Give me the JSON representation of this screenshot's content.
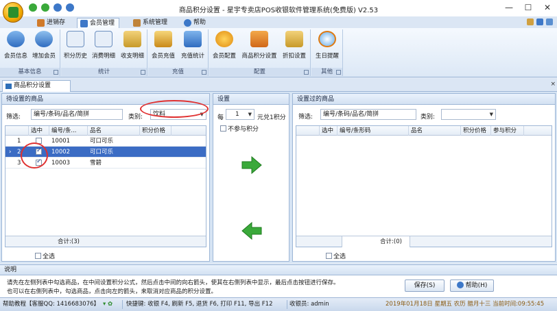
{
  "window": {
    "title": "商品积分设置 - 星宇专卖店POS收银软件管理系统(免费版) V2.53",
    "minimize": "—",
    "maximize": "☐",
    "close": "✕"
  },
  "ribbon_tabs": [
    {
      "label": "进销存",
      "icon": "cart-icon"
    },
    {
      "label": "会员管理",
      "icon": "members-icon",
      "active": true
    },
    {
      "label": "系统管理",
      "icon": "tools-icon"
    },
    {
      "label": "帮助",
      "icon": "help-icon"
    }
  ],
  "ribbon_groups": {
    "basic": {
      "label": "基本信息",
      "buttons": [
        "会员信息",
        "增加会员"
      ]
    },
    "stats": {
      "label": "统计",
      "buttons": [
        "积分历史",
        "消费明细",
        "收支明细"
      ]
    },
    "recharge": {
      "label": "充值",
      "buttons": [
        "会员充值",
        "充值统计"
      ]
    },
    "config": {
      "label": "配置",
      "buttons": [
        "会员配置",
        "商品积分设置",
        "折扣设置"
      ]
    },
    "other": {
      "label": "其他",
      "buttons": [
        "生日提醒"
      ]
    }
  },
  "panel_tab": "商品积分设置",
  "panel_more": "×",
  "left_pane": {
    "title": "待设置的商品",
    "filter_label": "筛选:",
    "filter_value": "编号/条码/品名/简拼",
    "category_label": "类别:",
    "category_value": "饮料",
    "columns": [
      "选中",
      "编号/条...",
      "品名",
      "积分价格"
    ],
    "rows": [
      {
        "idx": "1",
        "checked": false,
        "code": "10001",
        "name": "可口可乐",
        "points": ""
      },
      {
        "idx": "2",
        "checked": true,
        "code": "10002",
        "name": "可口可乐",
        "points": "",
        "selected": true,
        "marker": "›"
      },
      {
        "idx": "3",
        "checked": true,
        "code": "10003",
        "name": "雪碧",
        "points": ""
      }
    ],
    "total": "合计:(3)",
    "select_all": "全选"
  },
  "mid_pane": {
    "title": "设置",
    "per_label": "每",
    "per_value": "1",
    "rule_text": "元兑1积分",
    "no_points_label": "不参与积分"
  },
  "right_pane": {
    "title": "设置过的商品",
    "filter_label": "筛选:",
    "filter_value": "编号/条码/品名/简拼",
    "category_label": "类别:",
    "category_value": "",
    "columns": [
      "选中",
      "编号/条形码",
      "品名",
      "积分价格",
      "参与积分"
    ],
    "total": "合计:(0)",
    "select_all": "全选"
  },
  "description": {
    "title": "说明",
    "line1": "请先在左侧列表中勾选商品，在中间设置积分公式，然后点击中间的向右箭头，使其在右侧列表中显示，最后点击按钮进行保存。",
    "line2": "也可以在右侧列表中，勾选商品，点击向左的箭头，来取消对应商品的积分设置。",
    "save_label": "保存(S)",
    "help_label": "帮助(H)"
  },
  "statusbar": {
    "help": "帮助教程【客服QQ: 1416683076】",
    "shortcuts": "快捷键: 收银 F4, 刷新 F5, 退货 F6, 打印 F11, 导出 F12",
    "cashier": "收银员: admin",
    "datetime": "2019年01月18日 星期五 农历 腊月十三 当前时间:09:55:45"
  },
  "colors": {
    "accent": "#3b6cc4",
    "arrow_green": "#3aa93a",
    "annotation_red": "#e03030"
  }
}
